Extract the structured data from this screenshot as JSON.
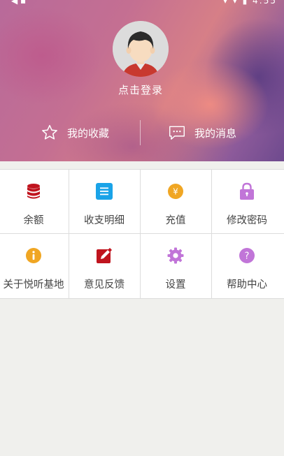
{
  "status_bar": {
    "time": "4:55"
  },
  "profile": {
    "login_label": "点击登录"
  },
  "quick_links": [
    {
      "label": "我的收藏",
      "icon": "star-icon"
    },
    {
      "label": "我的消息",
      "icon": "message-icon"
    }
  ],
  "menu": [
    {
      "label": "余额",
      "icon": "database-icon",
      "color": "#c0141e"
    },
    {
      "label": "收支明细",
      "icon": "list-icon",
      "color": "#1aa3e8"
    },
    {
      "label": "充值",
      "icon": "yen-coin-icon",
      "color": "#f0a623"
    },
    {
      "label": "修改密码",
      "icon": "lock-icon",
      "color": "#c175d8"
    },
    {
      "label": "关于悦听基地",
      "icon": "info-icon",
      "color": "#f0a623"
    },
    {
      "label": "意见反馈",
      "icon": "edit-icon",
      "color": "#c0141e"
    },
    {
      "label": "设置",
      "icon": "gear-icon",
      "color": "#c175d8"
    },
    {
      "label": "帮助中心",
      "icon": "help-icon",
      "color": "#c175d8"
    }
  ]
}
